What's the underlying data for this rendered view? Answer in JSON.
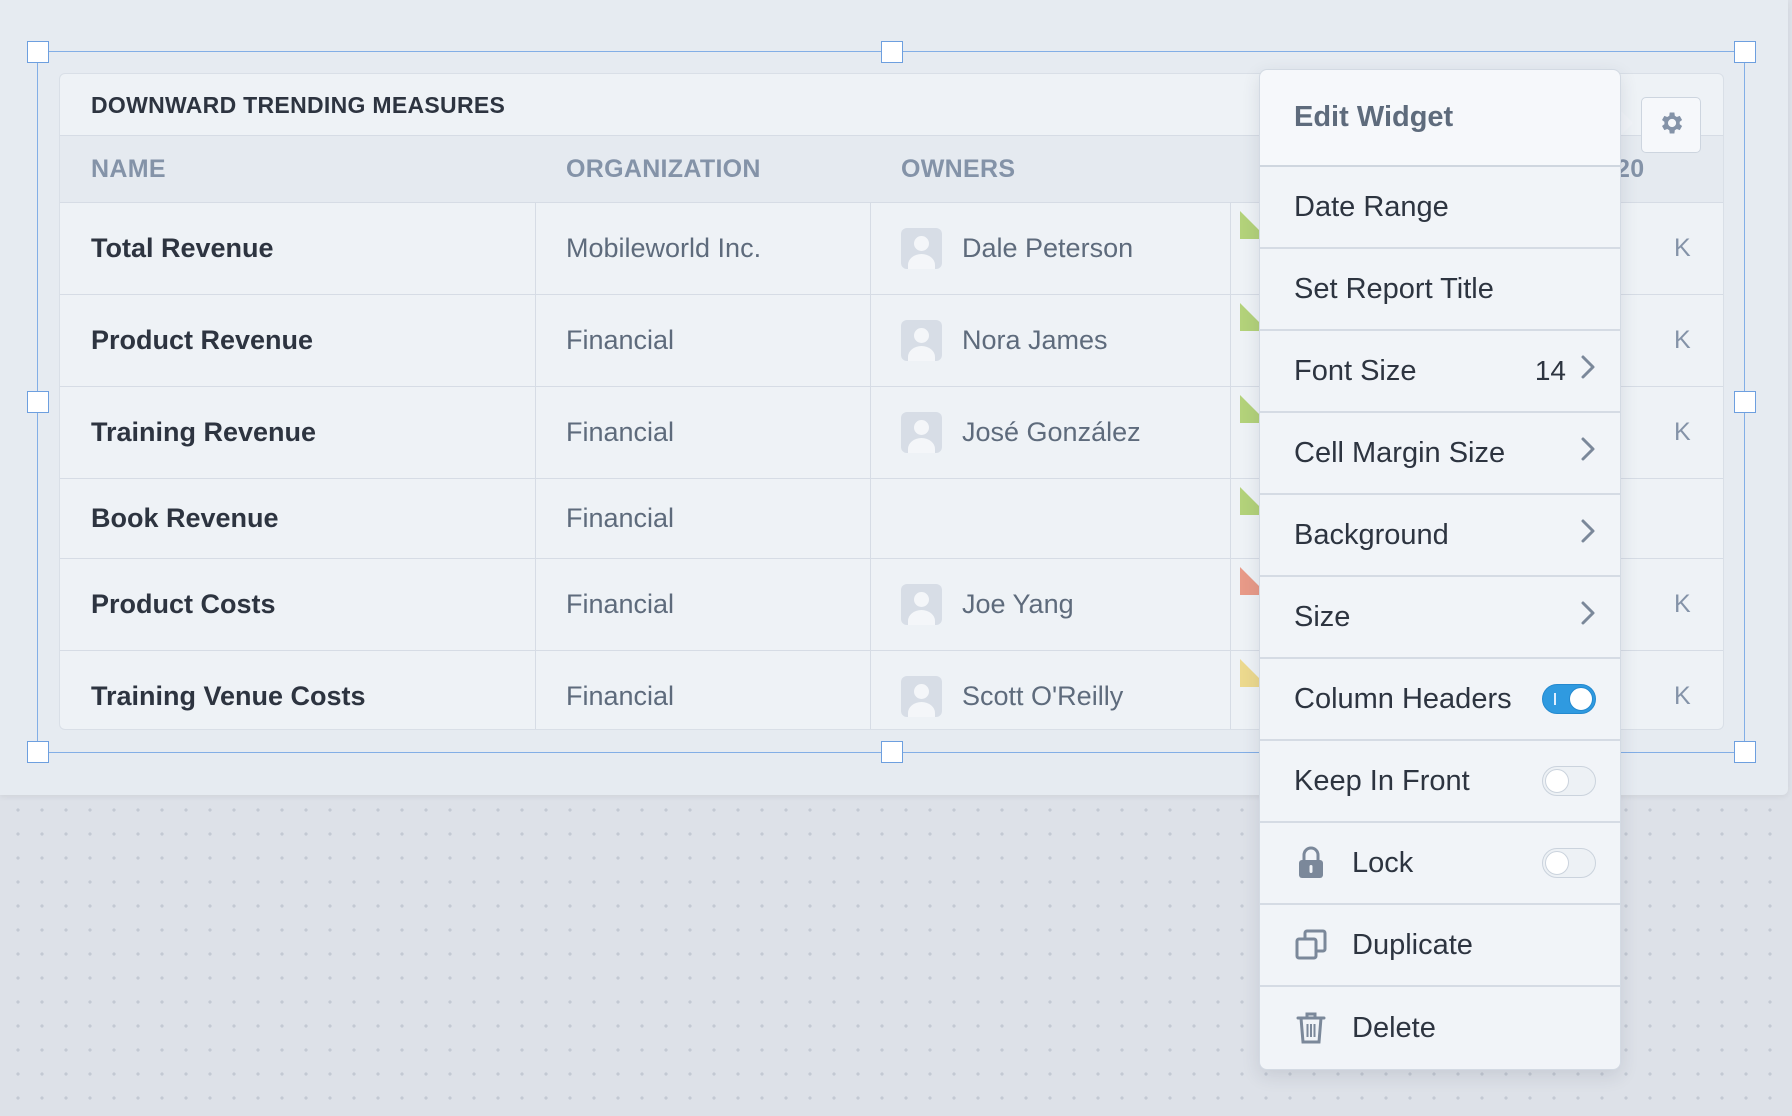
{
  "widget": {
    "title": "DOWNWARD TRENDING MEASURES",
    "columns": {
      "name": "NAME",
      "organization": "ORGANIZATION",
      "owners": "OWNERS",
      "clipped": "20"
    },
    "rows": [
      {
        "name": "Total Revenue",
        "organization": "Mobileworld Inc.",
        "owner": "Dale Peterson",
        "flag_color": "#b3d27a",
        "clipped": "K"
      },
      {
        "name": "Product Revenue",
        "organization": "Financial",
        "owner": "Nora James",
        "flag_color": "#b3d27a",
        "clipped": "K"
      },
      {
        "name": "Training Revenue",
        "organization": "Financial",
        "owner": "José González",
        "flag_color": "#b3d27a",
        "clipped": "K"
      },
      {
        "name": "Book Revenue",
        "organization": "Financial",
        "owner": "",
        "flag_color": "#b3d27a",
        "clipped": ""
      },
      {
        "name": "Product Costs",
        "organization": "Financial",
        "owner": "Joe Yang",
        "flag_color": "#e89a88",
        "clipped": "K"
      },
      {
        "name": "Training Venue Costs",
        "organization": "Financial",
        "owner": "Scott O'Reilly",
        "flag_color": "#ecd98e",
        "clipped": "K"
      }
    ]
  },
  "menu": {
    "header": "Edit Widget",
    "items": {
      "date_range": "Date Range",
      "set_report_title": "Set Report Title",
      "font_size": "Font Size",
      "font_size_value": "14",
      "cell_margin_size": "Cell Margin Size",
      "background": "Background",
      "size": "Size",
      "column_headers": "Column Headers",
      "keep_in_front": "Keep In Front",
      "lock": "Lock",
      "duplicate": "Duplicate",
      "delete": "Delete"
    },
    "toggles": {
      "column_headers": true,
      "keep_in_front": false,
      "lock": false
    }
  },
  "icons": {
    "settings": "gear-icon",
    "lock": "lock-icon",
    "duplicate": "duplicate-icon",
    "delete": "trash-icon",
    "submenu": "chevron-right-icon"
  },
  "colors": {
    "accent": "#2f9ae0",
    "selection": "#82aee6"
  }
}
